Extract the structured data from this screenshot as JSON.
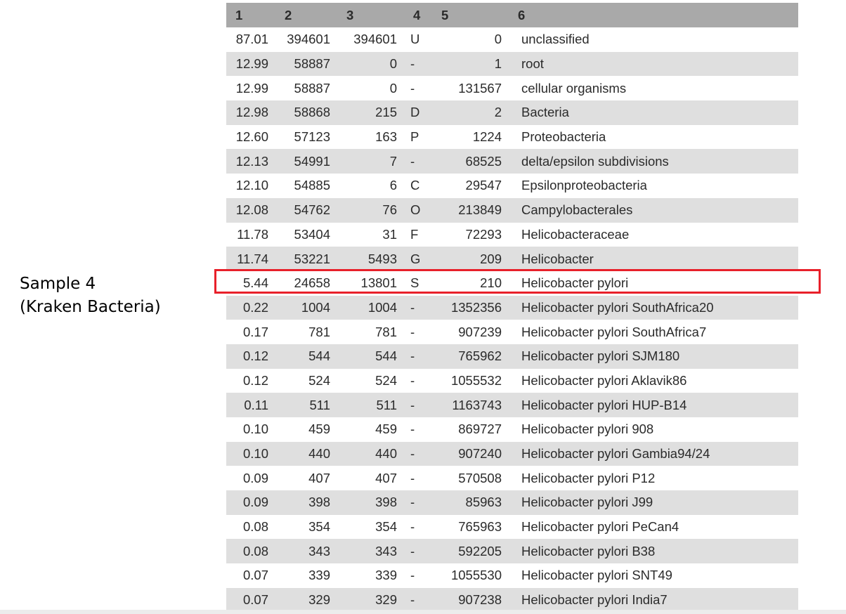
{
  "side_label": {
    "line1": "Sample 4",
    "line2": "(Kraken Bacteria)"
  },
  "table": {
    "headers": [
      "1",
      "2",
      "3",
      "4",
      "5",
      "6"
    ],
    "rows": [
      [
        "87.01",
        "394601",
        "394601",
        "U",
        "0",
        "unclassified"
      ],
      [
        "12.99",
        "58887",
        "0",
        "-",
        "1",
        "root"
      ],
      [
        "12.99",
        "58887",
        "0",
        "-",
        "131567",
        "cellular organisms"
      ],
      [
        "12.98",
        "58868",
        "215",
        "D",
        "2",
        "Bacteria"
      ],
      [
        "12.60",
        "57123",
        "163",
        "P",
        "1224",
        "Proteobacteria"
      ],
      [
        "12.13",
        "54991",
        "7",
        "-",
        "68525",
        "delta/epsilon subdivisions"
      ],
      [
        "12.10",
        "54885",
        "6",
        "C",
        "29547",
        "Epsilonproteobacteria"
      ],
      [
        "12.08",
        "54762",
        "76",
        "O",
        "213849",
        "Campylobacterales"
      ],
      [
        "11.78",
        "53404",
        "31",
        "F",
        "72293",
        "Helicobacteraceae"
      ],
      [
        "11.74",
        "53221",
        "5493",
        "G",
        "209",
        "Helicobacter"
      ],
      [
        "5.44",
        "24658",
        "13801",
        "S",
        "210",
        "Helicobacter pylori"
      ],
      [
        "0.22",
        "1004",
        "1004",
        "-",
        "1352356",
        "Helicobacter pylori SouthAfrica20"
      ],
      [
        "0.17",
        "781",
        "781",
        "-",
        "907239",
        "Helicobacter pylori SouthAfrica7"
      ],
      [
        "0.12",
        "544",
        "544",
        "-",
        "765962",
        "Helicobacter pylori SJM180"
      ],
      [
        "0.12",
        "524",
        "524",
        "-",
        "1055532",
        "Helicobacter pylori Aklavik86"
      ],
      [
        "0.11",
        "511",
        "511",
        "-",
        "1163743",
        "Helicobacter pylori HUP-B14"
      ],
      [
        "0.10",
        "459",
        "459",
        "-",
        "869727",
        "Helicobacter pylori 908"
      ],
      [
        "0.10",
        "440",
        "440",
        "-",
        "907240",
        "Helicobacter pylori Gambia94/24"
      ],
      [
        "0.09",
        "407",
        "407",
        "-",
        "570508",
        "Helicobacter pylori P12"
      ],
      [
        "0.09",
        "398",
        "398",
        "-",
        "85963",
        "Helicobacter pylori J99"
      ],
      [
        "0.08",
        "354",
        "354",
        "-",
        "765963",
        "Helicobacter pylori PeCan4"
      ],
      [
        "0.08",
        "343",
        "343",
        "-",
        "592205",
        "Helicobacter pylori B38"
      ],
      [
        "0.07",
        "339",
        "339",
        "-",
        "1055530",
        "Helicobacter pylori SNT49"
      ],
      [
        "0.07",
        "329",
        "329",
        "-",
        "907238",
        "Helicobacter pylori India7"
      ]
    ],
    "highlighted_row": 10
  },
  "colors": {
    "header_bg": "#a9a9a9",
    "stripe_bg": "#dfdfdf",
    "highlight_border": "#e8202a"
  }
}
